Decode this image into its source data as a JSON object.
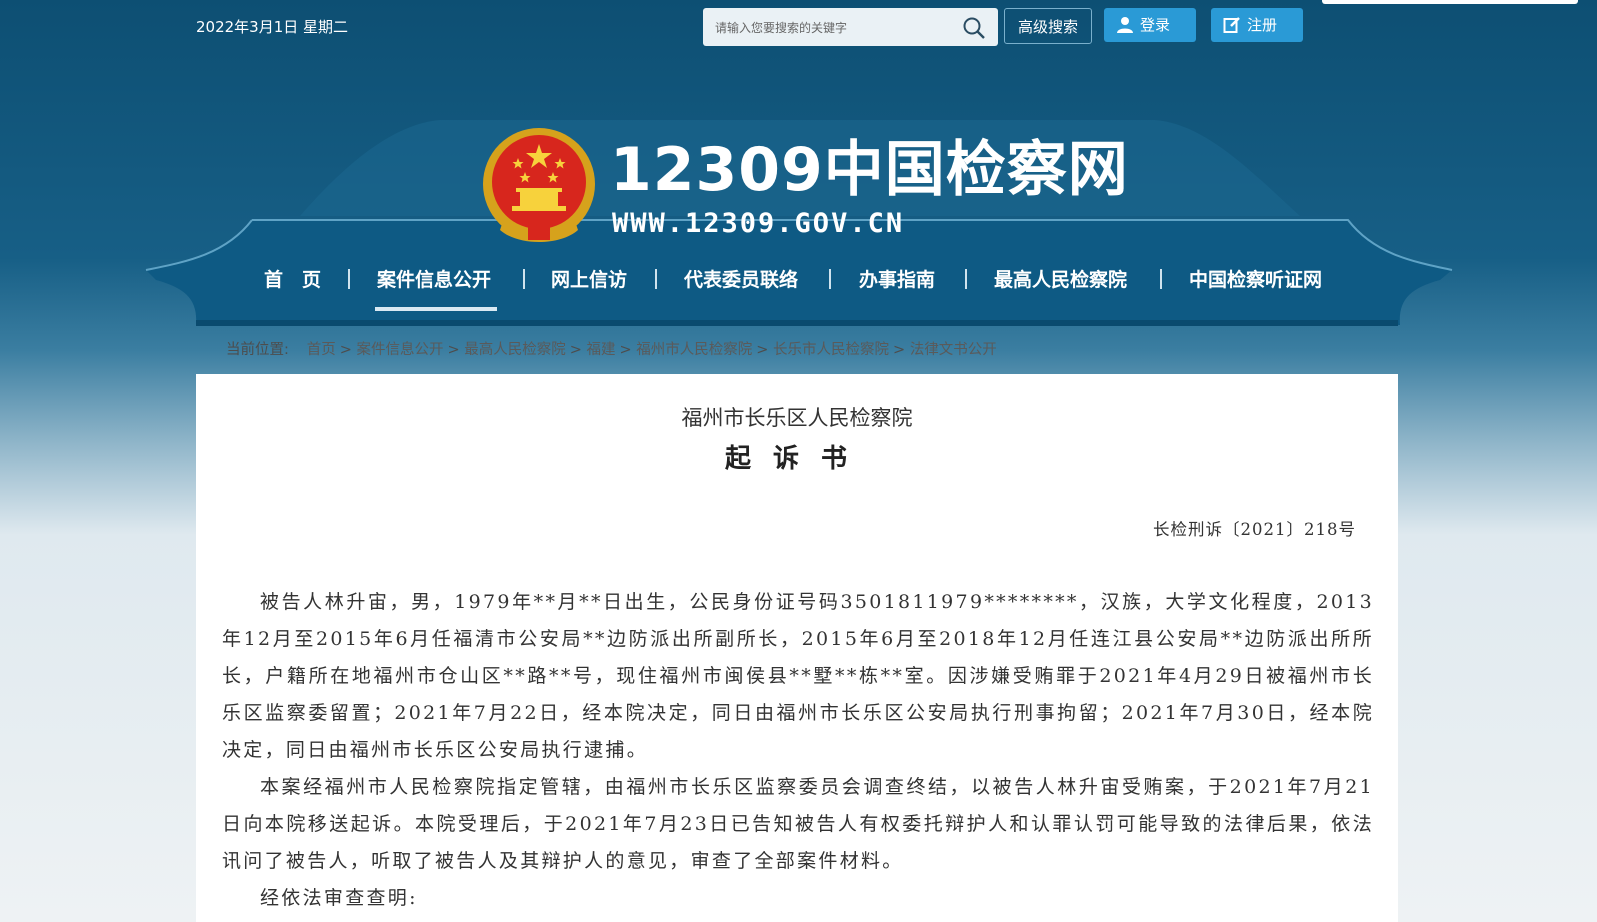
{
  "header": {
    "date": "2022年3月1日 星期二",
    "search_placeholder": "请输入您要搜索的关键字",
    "advanced_search": "高级搜索",
    "login": "登录",
    "register": "注册"
  },
  "brand": {
    "name": "12309中国检察网",
    "url": "WWW.12309.GOV.CN"
  },
  "nav": {
    "items": [
      "首　页",
      "案件信息公开",
      "网上信访",
      "代表委员联络",
      "办事指南",
      "最高人民检察院",
      "中国检察听证网"
    ],
    "active": "案件信息公开"
  },
  "breadcrumb": {
    "label": "当前位置:",
    "items": [
      "首页",
      "案件信息公开",
      "最高人民检察院",
      "福建",
      "福州市人民检察院",
      "长乐市人民检察院",
      "法律文书公开"
    ]
  },
  "document": {
    "org": "福州市长乐区人民检察院",
    "title": "起诉书",
    "number": "长检刑诉〔2021〕218号",
    "paragraphs": [
      "被告人林升宙，男，1979年**月**日出生，公民身份证号码3501811979********，汉族，大学文化程度，2013年12月至2015年6月任福清市公安局**边防派出所副所长，2015年6月至2018年12月任连江县公安局**边防派出所所长，户籍所在地福州市仓山区**路**号，现住福州市闽侯县**墅**栋**室。因涉嫌受贿罪于2021年4月29日被福州市长乐区监察委留置；2021年7月22日，经本院决定，同日由福州市长乐区公安局执行刑事拘留；2021年7月30日，经本院决定，同日由福州市长乐区公安局执行逮捕。",
      "本案经福州市人民检察院指定管辖，由福州市长乐区监察委员会调查终结，以被告人林升宙受贿案，于2021年7月21日向本院移送起诉。本院受理后，于2021年7月23日已告知被告人有权委托辩护人和认罪认罚可能导致的法律后果，依法讯问了被告人，听取了被告人及其辩护人的意见，审查了全部案件材料。",
      "经依法审查查明:"
    ]
  }
}
